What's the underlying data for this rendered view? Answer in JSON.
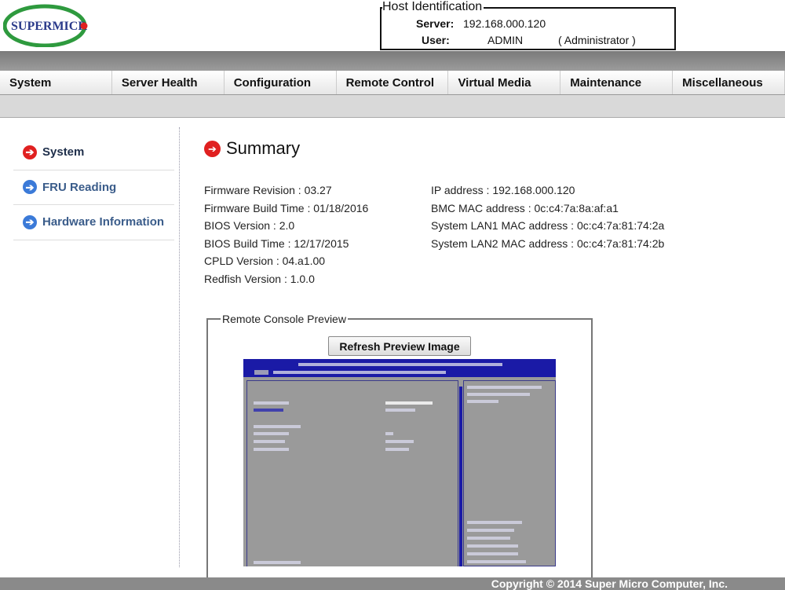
{
  "brand": {
    "logo_text": "SUPERMICRO"
  },
  "host": {
    "title": "Host Identification",
    "server_label": "Server:",
    "server_value": "192.168.000.120",
    "user_label": "User:",
    "user_value": "ADMIN",
    "user_role": "( Administrator )"
  },
  "nav": {
    "items": [
      "System",
      "Server Health",
      "Configuration",
      "Remote Control",
      "Virtual Media",
      "Maintenance",
      "Miscellaneous"
    ]
  },
  "sidebar": {
    "items": [
      {
        "label": "System",
        "active": true
      },
      {
        "label": "FRU Reading",
        "active": false
      },
      {
        "label": "Hardware Information",
        "active": false
      }
    ]
  },
  "summary": {
    "title": "Summary",
    "left": [
      "Firmware Revision :  03.27",
      "Firmware Build Time :  01/18/2016",
      "BIOS Version : 2.0",
      "BIOS Build Time : 12/17/2015",
      "CPLD Version : 04.a1.00",
      "Redfish Version : 1.0.0"
    ],
    "right": [
      "IP address :  192.168.000.120",
      "BMC MAC address :  0c:c4:7a:8a:af:a1",
      "System LAN1 MAC address :  0c:c4:7a:81:74:2a",
      "System LAN2 MAC address :  0c:c4:7a:81:74:2b"
    ]
  },
  "preview": {
    "legend": "Remote Console Preview",
    "refresh_label": "Refresh Preview Image"
  },
  "footer": {
    "copyright": "Copyright © 2014 Super Micro Computer, Inc."
  },
  "colors": {
    "active_arrow": "#e02020",
    "inactive_arrow": "#3b7ad8",
    "link": "#3a5c8a",
    "bios_blue": "#1a1aa6"
  }
}
